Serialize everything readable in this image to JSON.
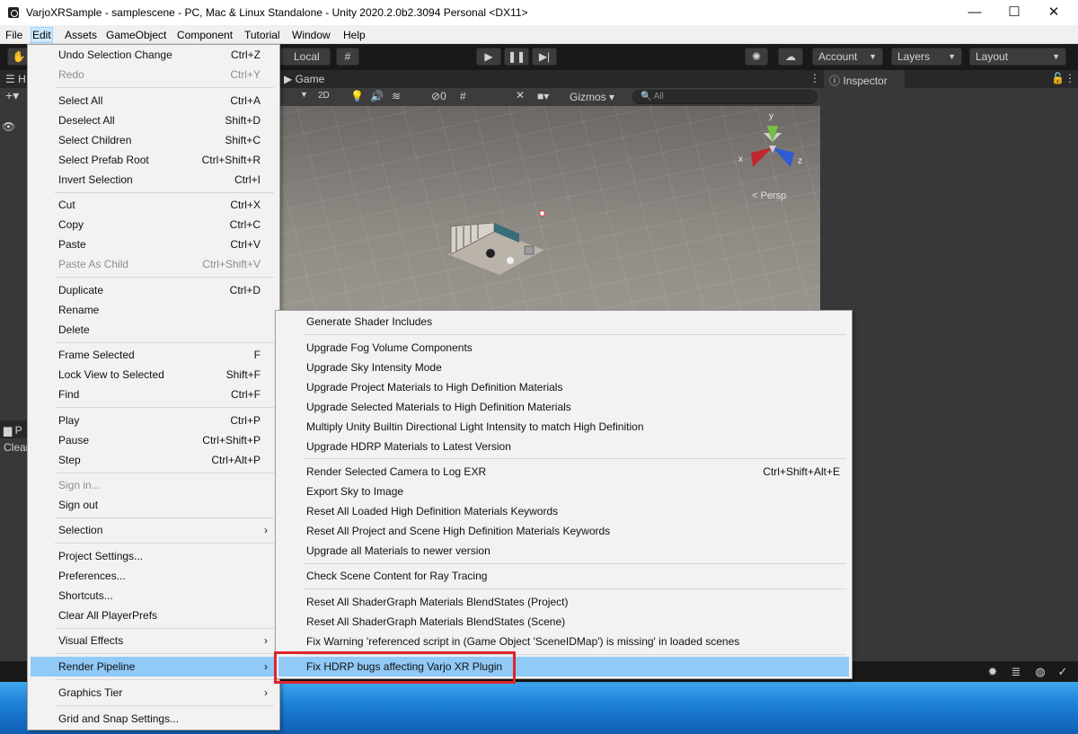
{
  "window": {
    "title": "VarjoXRSample - samplescene - PC, Mac & Linux Standalone - Unity 2020.2.0b2.3094 Personal <DX11>",
    "minimize": "—",
    "maximize": "☐",
    "close": "✕"
  },
  "menubar": [
    "File",
    "Edit",
    "Assets",
    "GameObject",
    "Component",
    "Tutorial",
    "Window",
    "Help"
  ],
  "toolbar": {
    "pivot_label": "Local",
    "account": "Account",
    "layers": "Layers",
    "layout": "Layout"
  },
  "panels": {
    "hierarchy_tab": "H",
    "game_tab": "Game",
    "inspector_tab": "Inspector",
    "project_tab": "P",
    "console_clear": "Clear",
    "scene_2d": "2D",
    "gizmos": "Gizmos",
    "search_placeholder": "All",
    "visibility_count": "0",
    "persp_label": "< Persp",
    "axis_x": "x",
    "axis_y": "y",
    "axis_z": "z"
  },
  "edit_menu": [
    {
      "label": "Undo Selection Change",
      "shortcut": "Ctrl+Z"
    },
    {
      "label": "Redo",
      "shortcut": "Ctrl+Y",
      "disabled": true
    },
    {
      "label": "Select All",
      "shortcut": "Ctrl+A"
    },
    {
      "label": "Deselect All",
      "shortcut": "Shift+D"
    },
    {
      "label": "Select Children",
      "shortcut": "Shift+C"
    },
    {
      "label": "Select Prefab Root",
      "shortcut": "Ctrl+Shift+R"
    },
    {
      "label": "Invert Selection",
      "shortcut": "Ctrl+I"
    },
    {
      "label": "Cut",
      "shortcut": "Ctrl+X"
    },
    {
      "label": "Copy",
      "shortcut": "Ctrl+C"
    },
    {
      "label": "Paste",
      "shortcut": "Ctrl+V"
    },
    {
      "label": "Paste As Child",
      "shortcut": "Ctrl+Shift+V",
      "disabled": true
    },
    {
      "label": "Duplicate",
      "shortcut": "Ctrl+D"
    },
    {
      "label": "Rename",
      "shortcut": ""
    },
    {
      "label": "Delete",
      "shortcut": ""
    },
    {
      "label": "Frame Selected",
      "shortcut": "F"
    },
    {
      "label": "Lock View to Selected",
      "shortcut": "Shift+F"
    },
    {
      "label": "Find",
      "shortcut": "Ctrl+F"
    },
    {
      "label": "Play",
      "shortcut": "Ctrl+P"
    },
    {
      "label": "Pause",
      "shortcut": "Ctrl+Shift+P"
    },
    {
      "label": "Step",
      "shortcut": "Ctrl+Alt+P"
    },
    {
      "label": "Sign in...",
      "shortcut": "",
      "disabled": true
    },
    {
      "label": "Sign out",
      "shortcut": ""
    },
    {
      "label": "Selection",
      "shortcut": ""
    },
    {
      "label": "Project Settings...",
      "shortcut": ""
    },
    {
      "label": "Preferences...",
      "shortcut": ""
    },
    {
      "label": "Shortcuts...",
      "shortcut": ""
    },
    {
      "label": "Clear All PlayerPrefs",
      "shortcut": ""
    },
    {
      "label": "Visual Effects",
      "shortcut": ""
    },
    {
      "label": "Render Pipeline",
      "shortcut": ""
    },
    {
      "label": "Graphics Tier",
      "shortcut": ""
    },
    {
      "label": "Grid and Snap Settings...",
      "shortcut": ""
    }
  ],
  "render_pipeline_menu": [
    {
      "label": "Generate Shader Includes",
      "shortcut": ""
    },
    {
      "label": "Upgrade Fog Volume Components",
      "shortcut": ""
    },
    {
      "label": "Upgrade Sky Intensity Mode",
      "shortcut": ""
    },
    {
      "label": "Upgrade Project Materials to High Definition Materials",
      "shortcut": ""
    },
    {
      "label": "Upgrade Selected Materials to High Definition Materials",
      "shortcut": ""
    },
    {
      "label": "Multiply Unity Builtin Directional Light Intensity to match High Definition",
      "shortcut": ""
    },
    {
      "label": "Upgrade HDRP Materials to Latest Version",
      "shortcut": ""
    },
    {
      "label": "Render Selected Camera to Log EXR",
      "shortcut": "Ctrl+Shift+Alt+E"
    },
    {
      "label": "Export Sky to Image",
      "shortcut": ""
    },
    {
      "label": "Reset All Loaded High Definition Materials Keywords",
      "shortcut": ""
    },
    {
      "label": "Reset All Project and Scene High Definition Materials Keywords",
      "shortcut": ""
    },
    {
      "label": "Upgrade all Materials to newer version",
      "shortcut": ""
    },
    {
      "label": "Check Scene Content for Ray Tracing",
      "shortcut": ""
    },
    {
      "label": "Reset All ShaderGraph Materials BlendStates (Project)",
      "shortcut": ""
    },
    {
      "label": "Reset All ShaderGraph Materials BlendStates (Scene)",
      "shortcut": ""
    },
    {
      "label": "Fix Warning 'referenced script in (Game Object 'SceneIDMap') is missing' in loaded scenes",
      "shortcut": ""
    },
    {
      "label": "Fix HDRP bugs affecting Varjo XR Plugin",
      "shortcut": ""
    }
  ]
}
